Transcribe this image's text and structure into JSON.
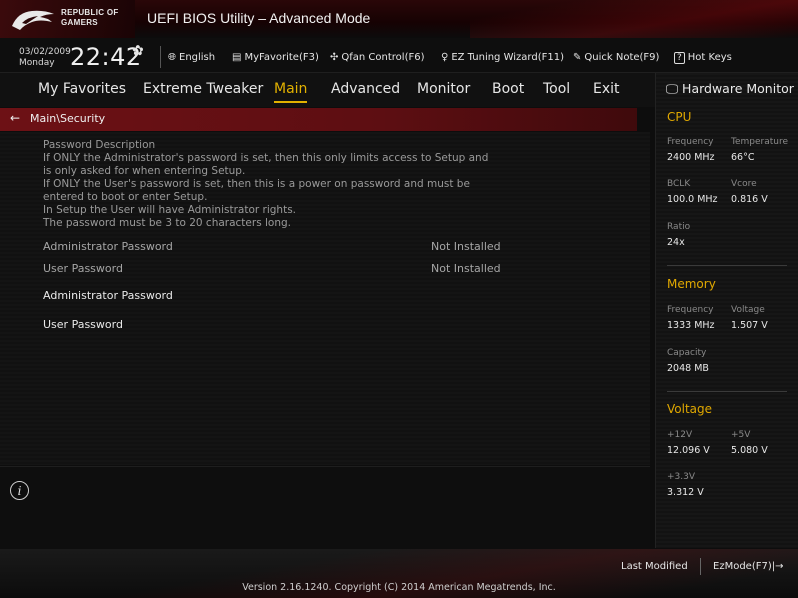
{
  "app": {
    "brand_line1": "REPUBLIC OF",
    "brand_line2": "GAMERS",
    "title": "UEFI BIOS Utility – Advanced Mode"
  },
  "toolbar": {
    "date": "03/02/2009",
    "day": "Monday",
    "time": "22:42",
    "items": [
      {
        "icon": "globe-icon",
        "label": "English"
      },
      {
        "icon": "favorite-icon",
        "label": "MyFavorite(F3)"
      },
      {
        "icon": "fan-icon",
        "label": "Qfan Control(F6)"
      },
      {
        "icon": "bulb-icon",
        "label": "EZ Tuning Wizard(F11)"
      },
      {
        "icon": "note-icon",
        "label": "Quick Note(F9)"
      },
      {
        "icon": "help-icon",
        "key": "?",
        "label": "Hot Keys"
      }
    ]
  },
  "nav": {
    "tabs": [
      "My Favorites",
      "Extreme Tweaker",
      "Main",
      "Advanced",
      "Monitor",
      "Boot",
      "Tool",
      "Exit"
    ],
    "active_tab": "Main"
  },
  "breadcrumb": "Main\\Security",
  "main": {
    "description": [
      "Password Description",
      "If ONLY the Administrator's password is set, then this only limits access to Setup and",
      "is only asked for when entering Setup.",
      "If ONLY the User's password is set, then this is a power on password and must be",
      "entered to boot or enter Setup.",
      "In Setup the User will have Administrator rights.",
      "The password must be 3 to 20 characters long."
    ],
    "status_rows": [
      {
        "label": "Administrator Password",
        "value": "Not Installed"
      },
      {
        "label": "User Password",
        "value": "Not Installed"
      }
    ],
    "actions": [
      "Administrator Password",
      "User Password"
    ]
  },
  "hardware_monitor": {
    "title": "Hardware Monitor",
    "cpu": {
      "heading": "CPU",
      "frequency_label": "Frequency",
      "frequency": "2400 MHz",
      "temperature_label": "Temperature",
      "temperature": "66°C",
      "bclk_label": "BCLK",
      "bclk": "100.0 MHz",
      "vcore_label": "Vcore",
      "vcore": "0.816 V",
      "ratio_label": "Ratio",
      "ratio": "24x"
    },
    "memory": {
      "heading": "Memory",
      "frequency_label": "Frequency",
      "frequency": "1333 MHz",
      "voltage_label": "Voltage",
      "voltage": "1.507 V",
      "capacity_label": "Capacity",
      "capacity": "2048 MB"
    },
    "voltage": {
      "heading": "Voltage",
      "v12_label": "+12V",
      "v12": "12.096 V",
      "v5_label": "+5V",
      "v5": "5.080 V",
      "v33_label": "+3.3V",
      "v33": "3.312 V"
    }
  },
  "footer": {
    "last_modified": "Last Modified",
    "ezmode": "EzMode(F7)|",
    "version": "Version 2.16.1240. Copyright (C) 2014 American Megatrends, Inc."
  },
  "colors": {
    "accent": "#e2b100",
    "breadcrumb_red": "#6d1115",
    "background": "#0d0d0d"
  }
}
